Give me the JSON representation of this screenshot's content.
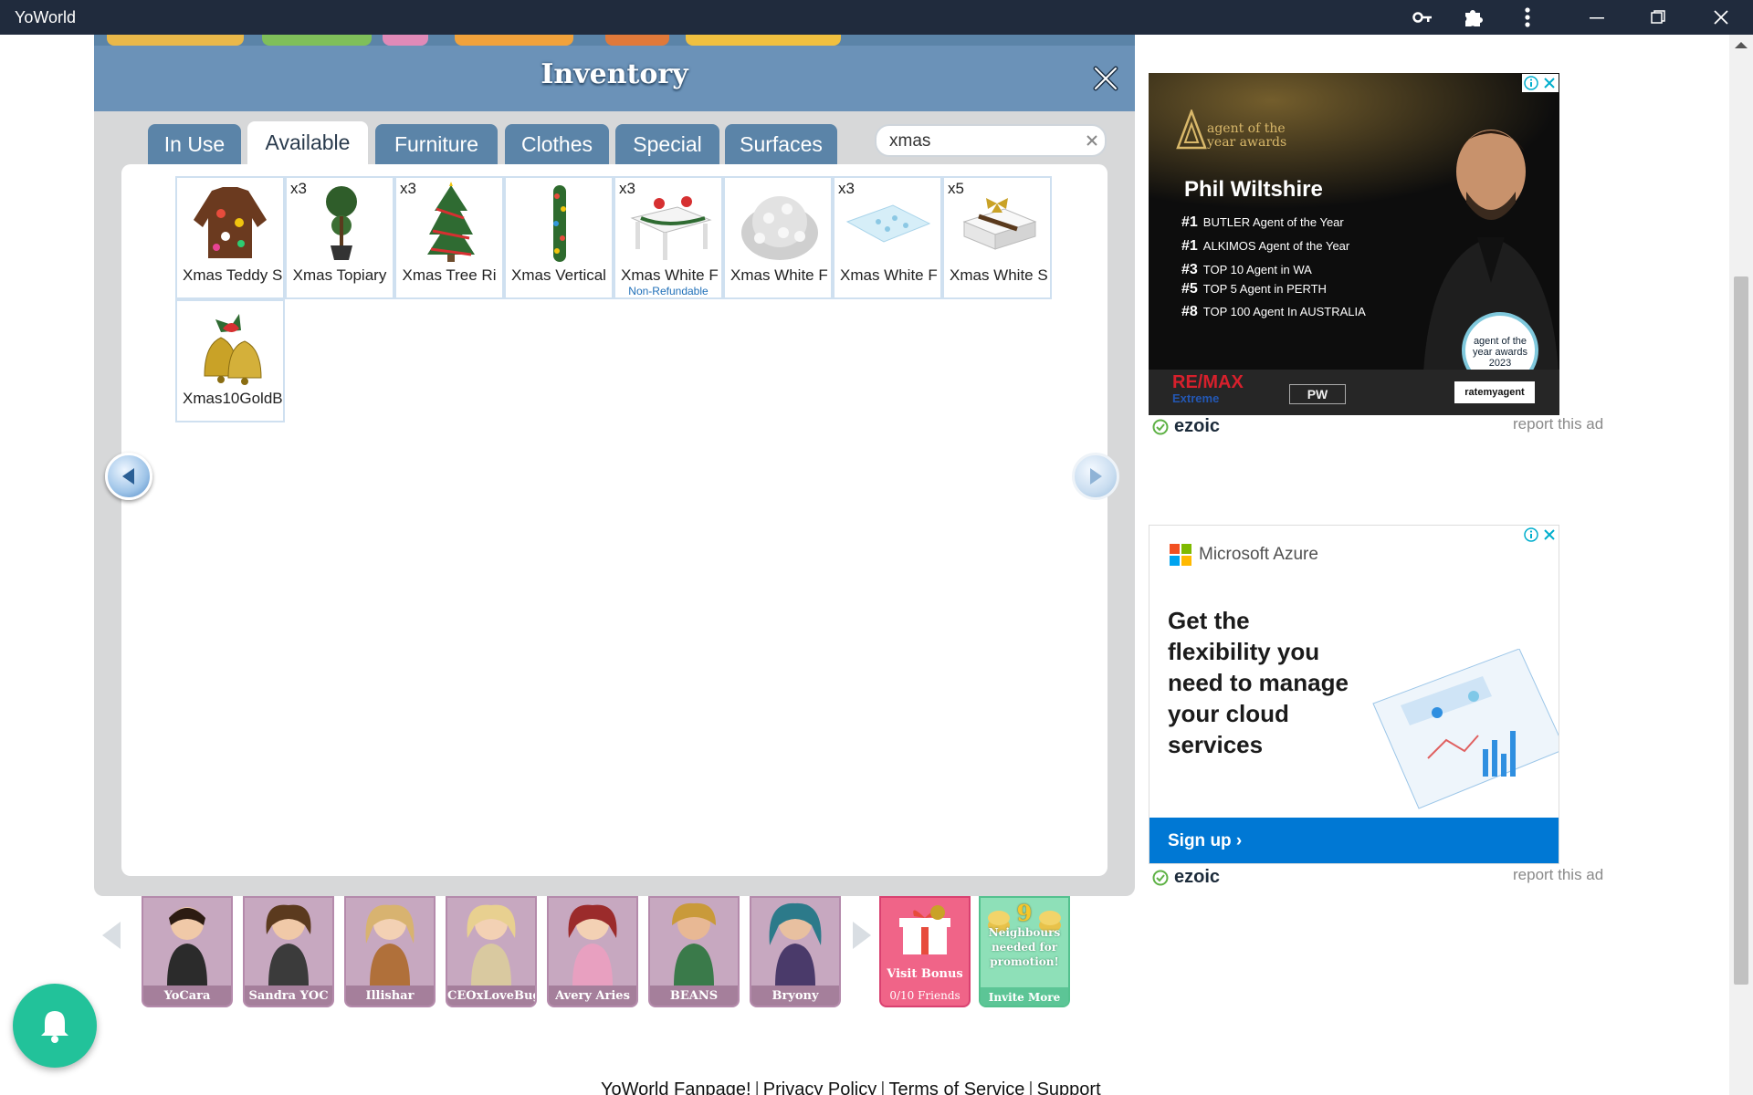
{
  "window": {
    "title": "YoWorld",
    "icons": [
      "key-icon",
      "puzzle-icon",
      "kebab-menu-icon",
      "minimize-icon",
      "restore-icon",
      "close-icon"
    ]
  },
  "inventory": {
    "title": "Inventory",
    "tabs": [
      {
        "label": "In Use",
        "active": false
      },
      {
        "label": "Available",
        "active": true
      },
      {
        "label": "Furniture",
        "active": false
      },
      {
        "label": "Clothes",
        "active": false
      },
      {
        "label": "Special",
        "active": false
      },
      {
        "label": "Surfaces",
        "active": false
      }
    ],
    "search": {
      "value": "xmas"
    },
    "items": [
      {
        "label": "Xmas Teddy S",
        "qty": "",
        "note": "",
        "icon": "ugly-sweater-icon"
      },
      {
        "label": "Xmas Topiary",
        "qty": "x3",
        "note": "",
        "icon": "topiary-icon"
      },
      {
        "label": "Xmas Tree Ri",
        "qty": "x3",
        "note": "",
        "icon": "xmas-tree-icon"
      },
      {
        "label": "Xmas Vertical",
        "qty": "",
        "note": "",
        "icon": "garland-icon"
      },
      {
        "label": "Xmas White F",
        "qty": "x3",
        "note": "Non-Refundable",
        "icon": "white-table-icon"
      },
      {
        "label": "Xmas White F",
        "qty": "",
        "note": "",
        "icon": "white-flower-pile-icon"
      },
      {
        "label": "Xmas White F",
        "qty": "x3",
        "note": "",
        "icon": "snow-rug-icon"
      },
      {
        "label": "Xmas White S",
        "qty": "x5",
        "note": "",
        "icon": "gift-box-icon"
      },
      {
        "label": "Xmas10GoldB",
        "qty": "",
        "note": "",
        "icon": "gold-bells-icon"
      }
    ]
  },
  "friends": [
    {
      "name": "YoCara"
    },
    {
      "name": "Sandra YOC"
    },
    {
      "name": "Illishar"
    },
    {
      "name": "CEOxLoveBug"
    },
    {
      "name": "Avery Aries"
    },
    {
      "name": "BEANS"
    },
    {
      "name": "Bryony"
    }
  ],
  "visit_bonus": {
    "title": "Visit Bonus",
    "count": "0/10 Friends"
  },
  "invite": {
    "number": "9",
    "text": "Neighbours needed for promotion!",
    "button": "Invite More"
  },
  "footer_links": [
    "YoWorld Fanpage!",
    "Privacy Policy",
    "Terms of Service",
    "Support"
  ],
  "ads": {
    "ad1": {
      "awards": "agent of the year awards",
      "name": "Phil Wiltshire",
      "ranks": [
        {
          "rank": "#1",
          "text": "BUTLER Agent of the Year"
        },
        {
          "rank": "#1",
          "text": "ALKIMOS Agent of the Year"
        },
        {
          "rank": "#3",
          "text": "TOP 10 Agent in WA"
        },
        {
          "rank": "#5",
          "text": "TOP 5 Agent in PERTH"
        },
        {
          "rank": "#8",
          "text": "TOP 100 Agent In AUSTRALIA"
        }
      ],
      "seal": "agent of the year awards 2023",
      "remax": "RE/MAX",
      "remax_sub": "Extreme",
      "pw": "PW",
      "rma": "ratemyagent"
    },
    "ad2": {
      "brand": "Microsoft Azure",
      "headline": "Get the flexibility you need to manage your cloud services",
      "cta": "Sign up"
    },
    "ezoic_label": "ezoic",
    "report_label": "report this ad"
  },
  "colors": {
    "header_blue": "#6b92b8",
    "tab_blue": "#5b84a8",
    "bell_green": "#22c29a",
    "visit_pink": "#f06488",
    "invite_green": "#8ee0b8"
  }
}
